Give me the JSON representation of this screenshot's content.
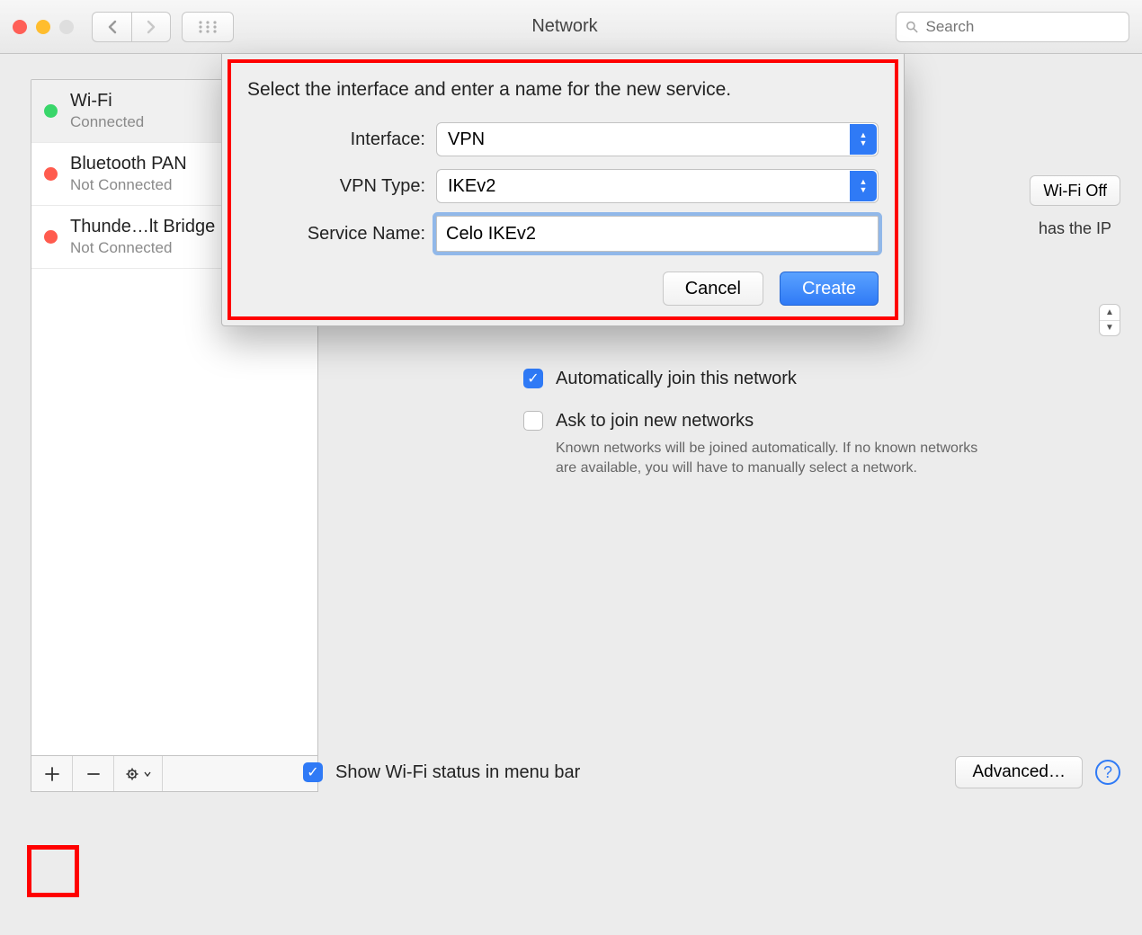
{
  "toolbar": {
    "title": "Network",
    "search_placeholder": "Search"
  },
  "sidebar": {
    "items": [
      {
        "name": "Wi-Fi",
        "status": "Connected",
        "color": "green"
      },
      {
        "name": "Bluetooth PAN",
        "status": "Not Connected",
        "color": "red"
      },
      {
        "name": "Thunde…lt Bridge",
        "status": "Not Connected",
        "color": "red"
      }
    ]
  },
  "detail": {
    "wifi_off_label": "Wi-Fi Off",
    "has_ip_fragment": "has the IP",
    "auto_join_label": "Automatically join this network",
    "ask_join_label": "Ask to join new networks",
    "ask_join_help": "Known networks will be joined automatically. If no known networks are available, you will have to manually select a network.",
    "show_status_label": "Show Wi-Fi status in menu bar",
    "advanced_label": "Advanced…"
  },
  "sheet": {
    "title": "Select the interface and enter a name for the new service.",
    "interface_label": "Interface:",
    "interface_value": "VPN",
    "vpntype_label": "VPN Type:",
    "vpntype_value": "IKEv2",
    "servicename_label": "Service Name:",
    "servicename_value": "Celo IKEv2",
    "cancel_label": "Cancel",
    "create_label": "Create"
  }
}
